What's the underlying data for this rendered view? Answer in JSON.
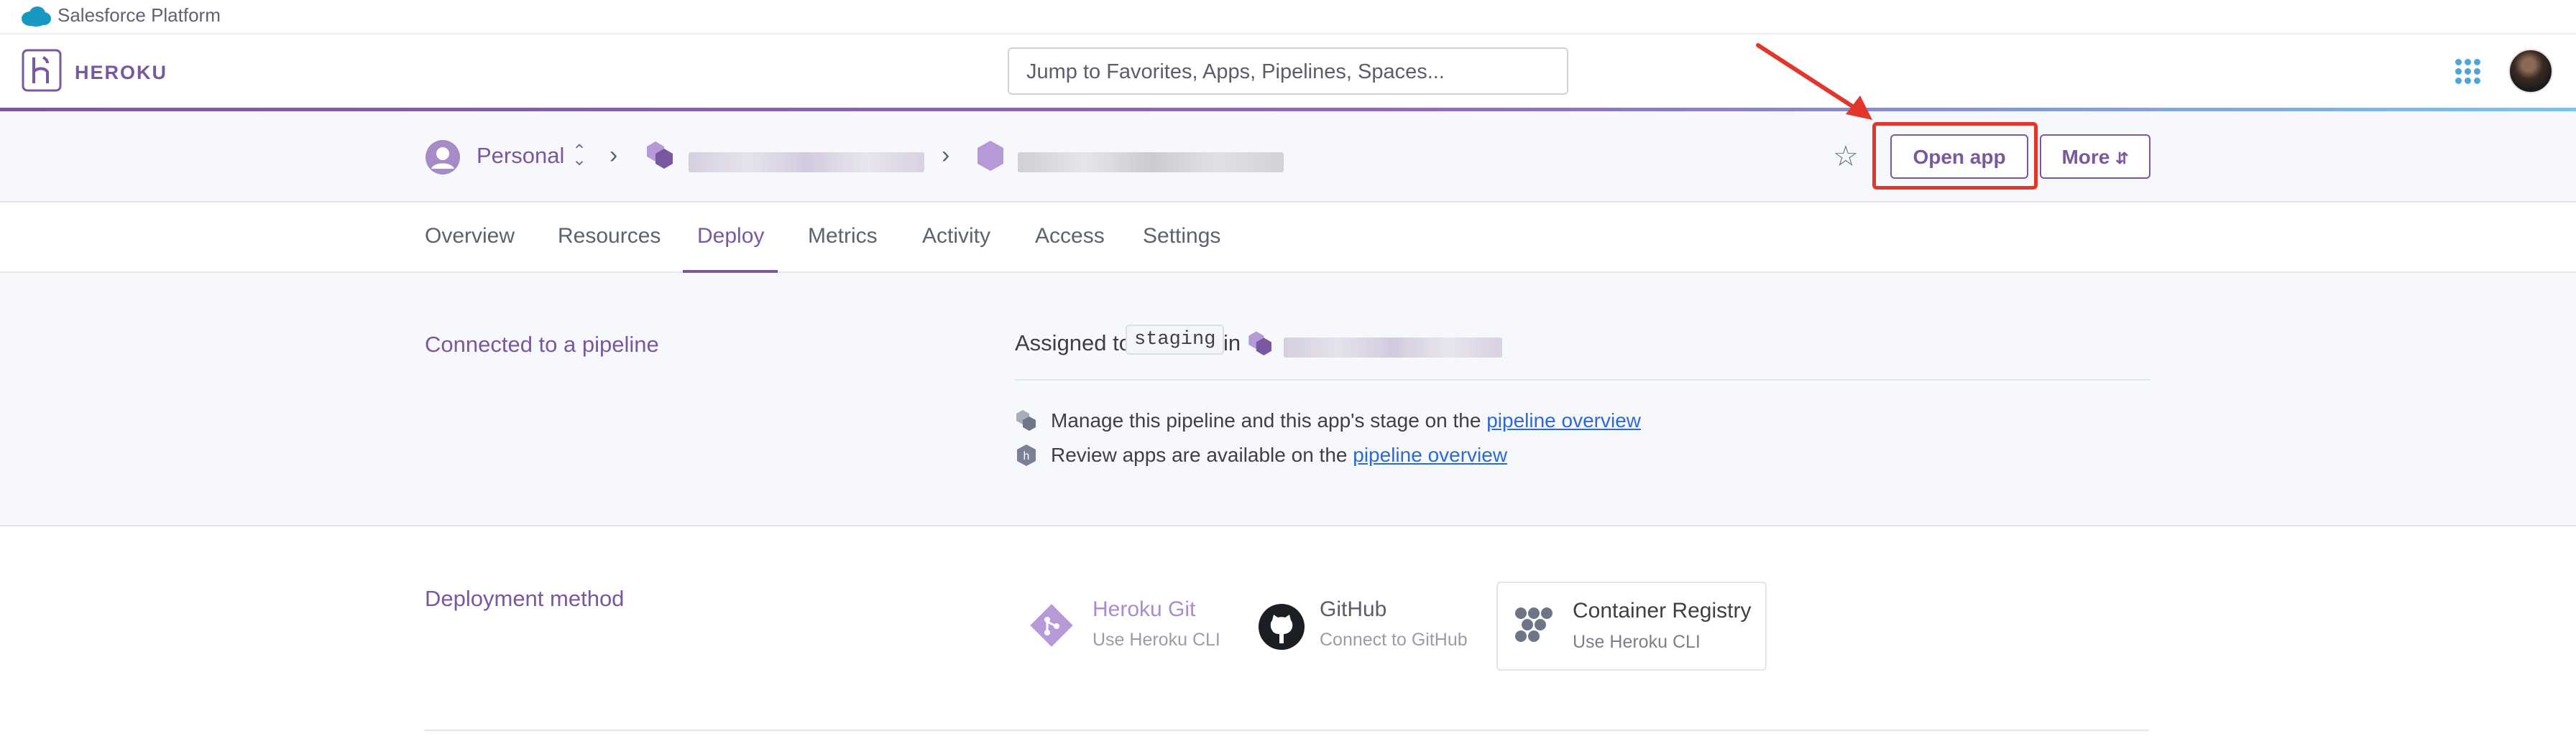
{
  "top_bar": {
    "brand": "Salesforce Platform",
    "icon": "salesforce-cloud-icon"
  },
  "header": {
    "logo_text": "HEROKU",
    "search_placeholder": "Jump to Favorites, Apps, Pipelines, Spaces...",
    "accent_color": "#79589f"
  },
  "app_bar": {
    "team": "Personal",
    "open_app_label": "Open app",
    "more_label": "More"
  },
  "tabs": [
    {
      "label": "Overview"
    },
    {
      "label": "Resources"
    },
    {
      "label": "Deploy",
      "active": true
    },
    {
      "label": "Metrics"
    },
    {
      "label": "Activity"
    },
    {
      "label": "Access"
    },
    {
      "label": "Settings"
    }
  ],
  "pipeline": {
    "title": "Connected to a pipeline",
    "assigned_to": "Assigned to",
    "stage": "staging",
    "in_word": "in",
    "manage_text": "Manage this pipeline and this app's stage on the",
    "review_text": "Review apps are available on the",
    "link_text": "pipeline overview"
  },
  "deployment": {
    "title": "Deployment method",
    "methods": [
      {
        "name": "Heroku Git",
        "sub": "Use Heroku CLI"
      },
      {
        "name": "GitHub",
        "sub": "Connect to GitHub"
      },
      {
        "name": "Container Registry",
        "sub": "Use Heroku CLI"
      }
    ]
  },
  "annotation": {
    "highlight_color": "#e1362b"
  }
}
